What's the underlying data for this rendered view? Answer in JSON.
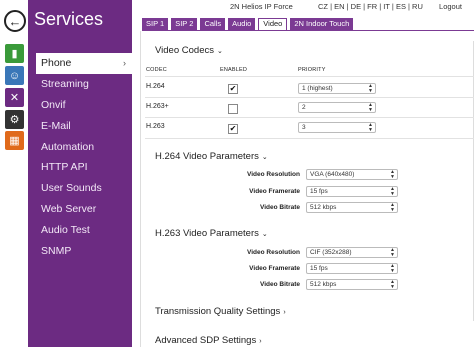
{
  "rail": {
    "back_glyph": "←",
    "icons": [
      {
        "name": "bar-chart-icon",
        "glyph": "▮",
        "color": "#3a9a3a"
      },
      {
        "name": "users-icon",
        "glyph": "☺",
        "color": "#3a77b8"
      },
      {
        "name": "tools-icon",
        "glyph": "✕",
        "color": "#6c2b82"
      },
      {
        "name": "gear-icon",
        "glyph": "⚙",
        "color": "#333333"
      },
      {
        "name": "grid-icon",
        "glyph": "▦",
        "color": "#e06a1b"
      }
    ]
  },
  "sidebar": {
    "title": "Services",
    "items": [
      {
        "label": "Phone",
        "active": true
      },
      {
        "label": "Streaming"
      },
      {
        "label": "Onvif"
      },
      {
        "label": "E-Mail"
      },
      {
        "label": "Automation"
      },
      {
        "label": "HTTP API"
      },
      {
        "label": "User Sounds"
      },
      {
        "label": "Web Server"
      },
      {
        "label": "Audio Test"
      },
      {
        "label": "SNMP"
      }
    ],
    "active_chevron": "›"
  },
  "topbar": {
    "device_name": "2N Helios IP Force",
    "languages": "CZ | EN | DE | FR | IT | ES | RU",
    "logout": "Logout"
  },
  "tabs": [
    {
      "label": "SIP 1"
    },
    {
      "label": "SIP 2"
    },
    {
      "label": "Calls"
    },
    {
      "label": "Audio"
    },
    {
      "label": "Video",
      "active": true
    },
    {
      "label": "2N Indoor Touch"
    }
  ],
  "video_codecs": {
    "title": "Video Codecs",
    "columns": {
      "codec": "CODEC",
      "enabled": "ENABLED",
      "priority": "PRIORITY"
    },
    "rows": [
      {
        "codec": "H.264",
        "enabled": true,
        "check": "✔",
        "priority": "1 (highest)"
      },
      {
        "codec": "H.263+",
        "enabled": false,
        "check": "",
        "priority": "2"
      },
      {
        "codec": "H.263",
        "enabled": true,
        "check": "✔",
        "priority": "3"
      }
    ]
  },
  "h264_params": {
    "title": "H.264 Video Parameters",
    "fields": [
      {
        "label": "Video Resolution",
        "value": "VGA (640x480)"
      },
      {
        "label": "Video Framerate",
        "value": "15 fps"
      },
      {
        "label": "Video Bitrate",
        "value": "512 kbps"
      }
    ]
  },
  "h263_params": {
    "title": "H.263 Video Parameters",
    "fields": [
      {
        "label": "Video Resolution",
        "value": "CIF (352x288)"
      },
      {
        "label": "Video Framerate",
        "value": "15 fps"
      },
      {
        "label": "Video Bitrate",
        "value": "512 kbps"
      }
    ]
  },
  "collapsed_sections": [
    {
      "title": "Transmission Quality Settings"
    },
    {
      "title": "Advanced SDP Settings"
    }
  ],
  "carets": {
    "down": "⌄",
    "right": "›",
    "select_arrows": "▲▼"
  }
}
